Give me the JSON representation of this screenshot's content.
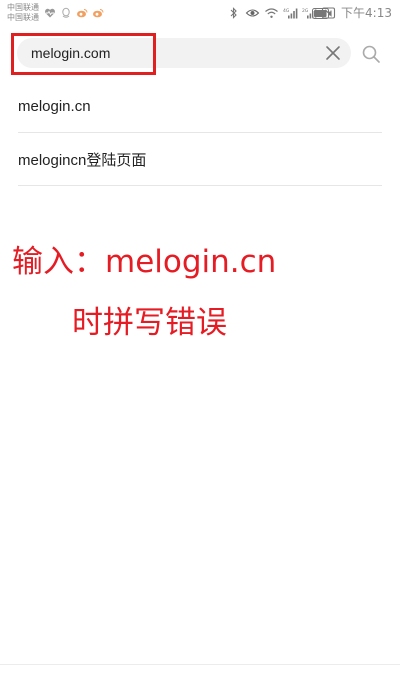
{
  "status_bar": {
    "carrier_1": "中国联通",
    "carrier_2": "中国联通",
    "time": "下午4:13",
    "network_labels": [
      "4G",
      "2G"
    ],
    "notification_icons": [
      "heart-rate-icon",
      "qq-icon",
      "weibo-icon",
      "weibo-icon"
    ],
    "system_icons": [
      "bluetooth-icon",
      "eye-comfort-icon",
      "wifi-icon",
      "signal-4g-icon",
      "signal-2g-icon",
      "nfc-icon",
      "battery-icon"
    ]
  },
  "search": {
    "value": "melogin.com",
    "clear_icon": "close-icon",
    "search_icon": "search-icon"
  },
  "suggestions": [
    {
      "label": "melogin.cn"
    },
    {
      "label": "melogincn登陆页面"
    }
  ],
  "annotation": {
    "line_1": "输入：melogin.cn",
    "line_2": "时拼写错误",
    "color": "#e51c23"
  },
  "colors": {
    "highlight_box": "#e02020",
    "search_bg": "#f2f2f2",
    "divider": "#e6e6e6"
  }
}
